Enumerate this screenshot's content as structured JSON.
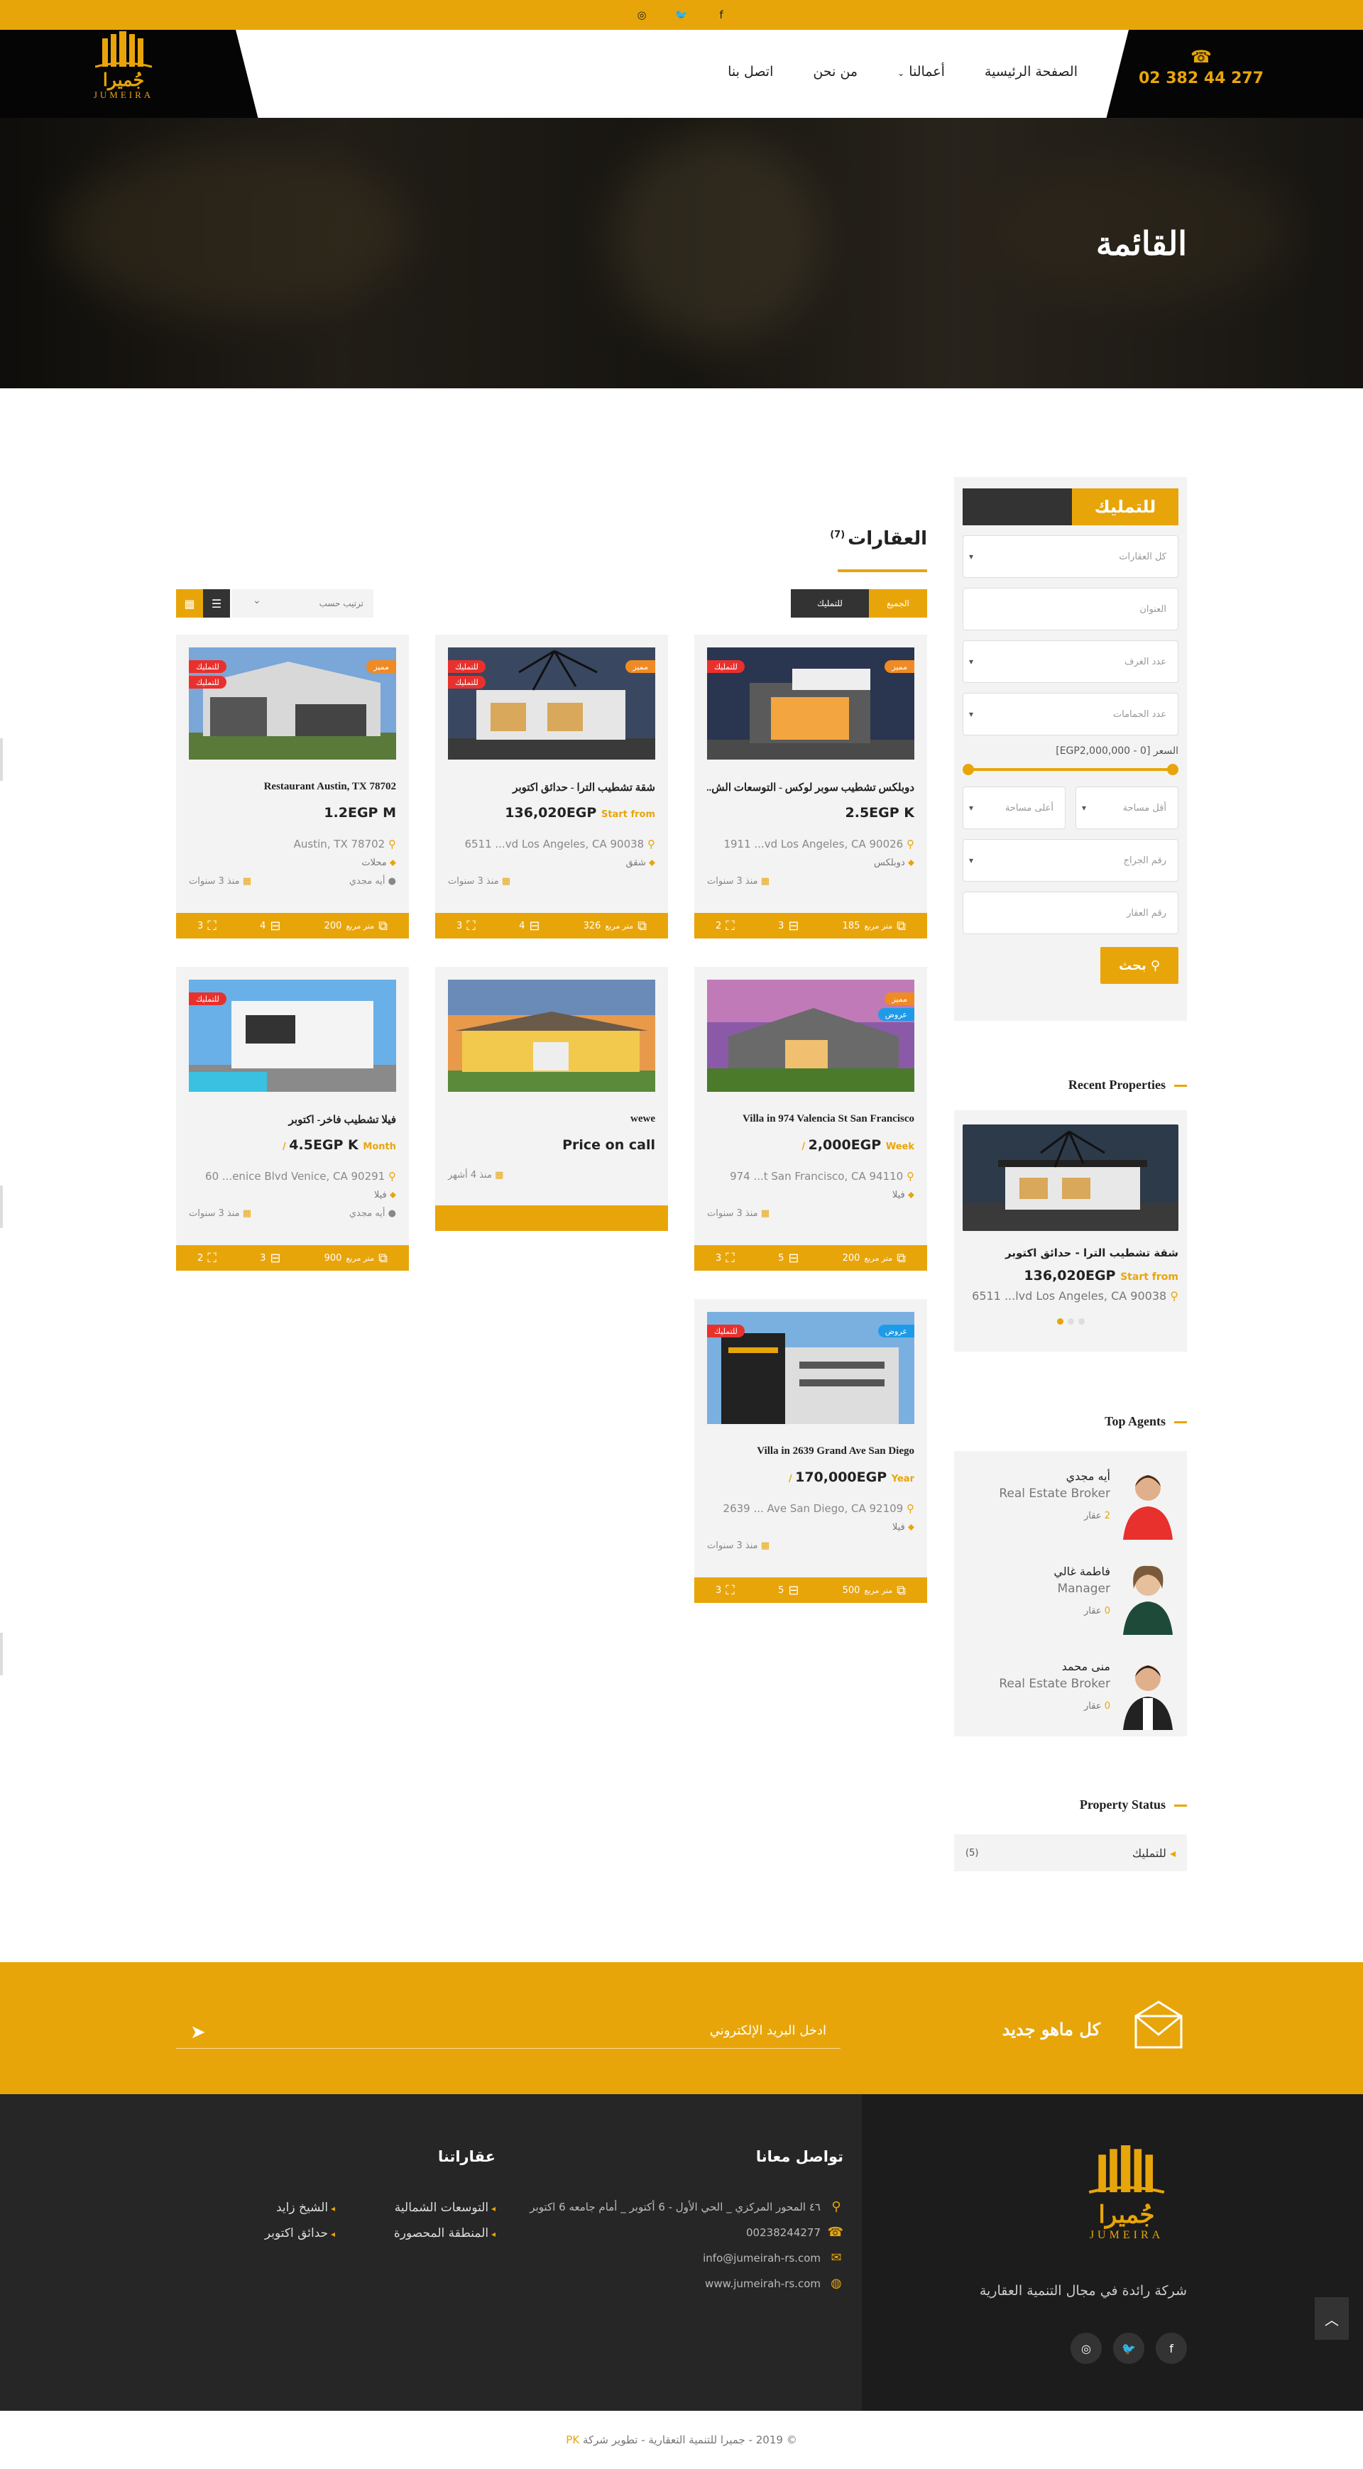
{
  "topbar": {
    "icons": [
      "instagram-icon",
      "twitter-icon",
      "facebook-icon"
    ],
    "glyphs": [
      "◎",
      "🐦",
      "f"
    ]
  },
  "header": {
    "phone": "02 382 44 277",
    "nav": [
      "الصفحة الرئيسية",
      "أعمالنا",
      "من نحن",
      "اتصل بنا"
    ],
    "logo_ar": "جُميرا",
    "logo_en": "JUMEIRA"
  },
  "hero": {
    "title": "القائمة"
  },
  "listing": {
    "title": "العقارات",
    "count": "(7)",
    "sort_placeholder": "ترتيب حسب",
    "filter_all": "الجميع",
    "filter_sale": "للتمليك"
  },
  "search": {
    "tab_label": "للتمليك",
    "all_properties": "كل العقارات",
    "address": "العنوان",
    "rooms": "عدد الغرف",
    "baths": "عدد الحمامات",
    "price_label": "السعر [0 - EGP2,000,000]",
    "min_area": "أقل مساحة",
    "max_area": "أعلى مساحة",
    "garages": "رقم الجراج",
    "property_id": "رقم العقار",
    "button": "بحث"
  },
  "recent": {
    "title": "Recent Properties",
    "item_title": "شقة تشطيب الترا - حدائق اكتوبر",
    "item_price": "136,020EGP",
    "item_start": "Start from",
    "item_addr": "6511 ...lvd Los Angeles, CA 90038"
  },
  "agents": {
    "title": "Top Agents",
    "items": [
      {
        "name": "أيه مجدي",
        "role": "Real Estate Broker",
        "count": "2",
        "unit": "عقار"
      },
      {
        "name": "فاطمة غالي",
        "role": "Manager",
        "count": "0",
        "unit": "عقار"
      },
      {
        "name": "منى محمد",
        "role": "Real Estate Broker",
        "count": "0",
        "unit": "عقار"
      }
    ]
  },
  "status": {
    "title": "Property Status",
    "name": "للتمليك",
    "count": "(5)"
  },
  "cards": [
    {
      "title": "دوبلكس تشطيب سوبر لوكس - التوسعات الش...",
      "price": "2.5EGP K",
      "note": "",
      "addr": "1911 ...vd Los Angeles, CA 90026",
      "type": "دوبلكس",
      "age": "منذ 3 سنوات",
      "agent": "",
      "area": "185",
      "beds": "3",
      "baths": "2",
      "badges": [
        "للتمليك",
        "مميز"
      ]
    },
    {
      "title": "شقة تشطيب الترا - حدائق اكتوبر",
      "price": "136,020EGP",
      "note": "Start from",
      "addr": "6511 ...vd Los Angeles, CA 90038",
      "type": "شقق",
      "age": "منذ 3 سنوات",
      "agent": "",
      "area": "326",
      "beds": "4",
      "baths": "3",
      "badges": [
        "للتمليك",
        "مميز",
        "للتمليك"
      ]
    },
    {
      "title": "Restaurant Austin, TX 78702",
      "price": "1.2EGP M",
      "note": "",
      "addr": "Austin, TX 78702",
      "type": "محلات",
      "age": "منذ 3 سنوات",
      "agent": "أيه مجدي",
      "area": "200",
      "beds": "4",
      "baths": "3",
      "badges": [
        "للتمليك",
        "مميز",
        "للتمليك"
      ]
    },
    {
      "title": "Villa in 974 Valencia St San Francisco",
      "price": "2,000EGP",
      "note": "Week /",
      "addr": "974 ...t San Francisco, CA 94110",
      "type": "فيلا",
      "age": "منذ 3 سنوات",
      "agent": "",
      "area": "200",
      "beds": "5",
      "baths": "3",
      "badges": [
        "مميز",
        "عروض"
      ]
    },
    {
      "title": "wewe",
      "price": "Price on call",
      "note": "",
      "addr": "",
      "type": "",
      "age": "منذ 4 أشهر",
      "agent": "",
      "area": "",
      "beds": "",
      "baths": "",
      "badges": []
    },
    {
      "title": "فيلا تشطيب فاخر- اكتوبر",
      "price": "4.5EGP K",
      "note": "Month /",
      "addr": "60 ...enice Blvd Venice, CA 90291",
      "type": "فيلا",
      "age": "منذ 3 سنوات",
      "agent": "أيه مجدي",
      "area": "900",
      "beds": "3",
      "baths": "2",
      "badges": [
        "للتمليك"
      ]
    },
    {
      "title": "Villa in 2639 Grand Ave San Diego",
      "price": "170,000EGP",
      "note": "Year /",
      "addr": "2639 ... Ave San Diego, CA 92109",
      "type": "فيلا",
      "age": "منذ 3 سنوات",
      "agent": "",
      "area": "500",
      "beds": "5",
      "baths": "3",
      "badges": [
        "للتمليك",
        "عروض"
      ]
    }
  ],
  "units": {
    "area_unit": "متر مربع"
  },
  "newsletter": {
    "title": "كل ماهو جديد",
    "placeholder": "ادخل البريد الإلكتروني"
  },
  "footer": {
    "desc": "شركة رائدة في مجال التنمية العقارية",
    "contact_title": "تواصل معانا",
    "address": "٤٦ المحور المركزي _ الحي الأول - 6 أكتوبر _ أمام جامعه 6 اكتوبر",
    "phone": "00238244277",
    "email": "info@jumeirah-rs.com",
    "web": "www.jumeirah-rs.com",
    "props_title": "عقاراتنا",
    "links": [
      "التوسعات الشمالية",
      "الشيخ زايد",
      "المنطقة المحصورة",
      "حدائق اكتوبر"
    ],
    "social_icons": [
      "facebook-icon",
      "twitter-icon",
      "instagram-icon"
    ],
    "social_glyphs": [
      "f",
      "🐦",
      "◎"
    ]
  },
  "copyright": {
    "text": "© 2019 - جميرا للتنمية التعقارية - تطوير شركة",
    "brand": "PK"
  },
  "colors": {
    "accent": "#e8a50a",
    "dark": "#262626",
    "badge_red": "#e8312d",
    "badge_orange": "#f08a24",
    "badge_blue": "#1e9be8"
  }
}
